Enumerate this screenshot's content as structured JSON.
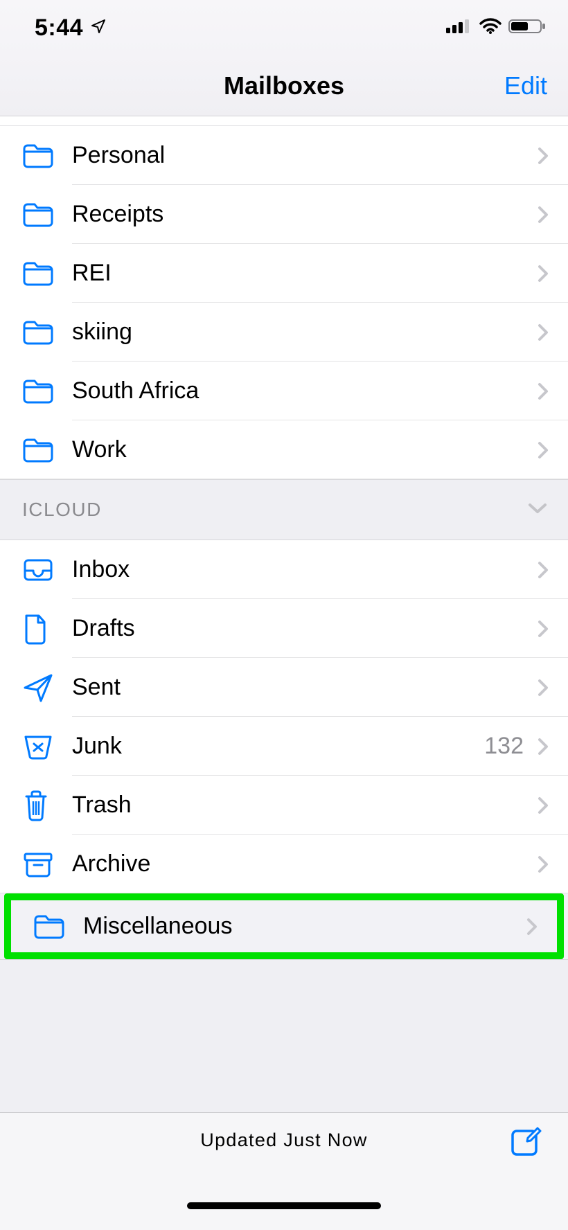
{
  "status": {
    "time": "5:44"
  },
  "nav": {
    "title": "Mailboxes",
    "edit": "Edit"
  },
  "folders_top": [
    {
      "name": "Personal",
      "icon": "folder"
    },
    {
      "name": "Receipts",
      "icon": "folder"
    },
    {
      "name": "REI",
      "icon": "folder"
    },
    {
      "name": "skiing",
      "icon": "folder"
    },
    {
      "name": "South Africa",
      "icon": "folder"
    },
    {
      "name": "Work",
      "icon": "folder"
    }
  ],
  "section": {
    "title": "ICLOUD"
  },
  "icloud": [
    {
      "name": "Inbox",
      "icon": "inbox",
      "count": ""
    },
    {
      "name": "Drafts",
      "icon": "doc",
      "count": ""
    },
    {
      "name": "Sent",
      "icon": "send",
      "count": ""
    },
    {
      "name": "Junk",
      "icon": "junk",
      "count": "132"
    },
    {
      "name": "Trash",
      "icon": "trash",
      "count": ""
    },
    {
      "name": "Archive",
      "icon": "archive",
      "count": ""
    }
  ],
  "highlight": {
    "name": "Miscellaneous",
    "icon": "folder"
  },
  "toolbar": {
    "status": "Updated Just Now"
  },
  "colors": {
    "accent": "#007aff",
    "highlight": "#00e000"
  }
}
